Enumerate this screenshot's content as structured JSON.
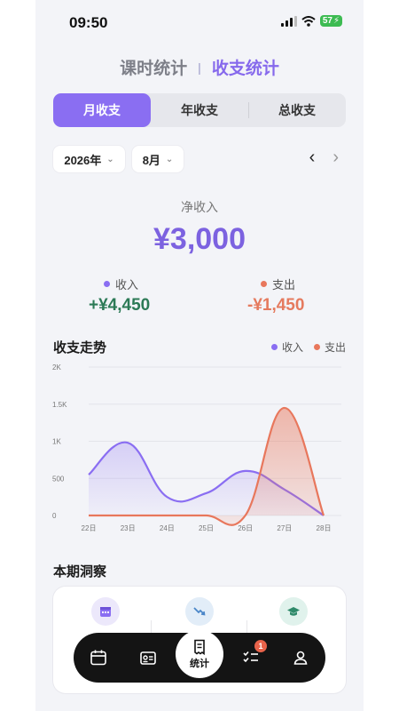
{
  "status": {
    "time": "09:50",
    "battery": "57"
  },
  "title": {
    "left": "课时统计",
    "separator": "|",
    "right": "收支统计"
  },
  "segments": [
    "月收支",
    "年收支",
    "总收支"
  ],
  "filters": {
    "year": "2026年",
    "month": "8月"
  },
  "summary": {
    "net_label": "净收入",
    "net_value": "¥3,000",
    "income_label": "收入",
    "income_value": "+¥4,450",
    "expense_label": "支出",
    "expense_value": "-¥1,450"
  },
  "trend": {
    "title": "收支走势",
    "legend_income": "收入",
    "legend_expense": "支出"
  },
  "chart_data": {
    "type": "area",
    "x": [
      "22日",
      "23日",
      "24日",
      "25日",
      "26日",
      "27日",
      "28日"
    ],
    "series": [
      {
        "name": "收入",
        "values": [
          550,
          980,
          250,
          300,
          600,
          350,
          0
        ]
      },
      {
        "name": "支出",
        "values": [
          0,
          0,
          0,
          0,
          0,
          1450,
          0
        ]
      }
    ],
    "yticks": [
      "0",
      "500",
      "1K",
      "1.5K",
      "2K"
    ],
    "ylim": [
      0,
      2000
    ],
    "grid": true,
    "legend": "top-right",
    "colors": {
      "income": "#8a6ef2",
      "expense": "#e8775c"
    }
  },
  "insights": {
    "title": "本期洞察"
  },
  "tabbar": {
    "active_label": "统计",
    "badge": "1"
  },
  "colors": {
    "accent": "#8a6ef2",
    "income": "#2c7a56",
    "expense": "#e57a5e"
  }
}
